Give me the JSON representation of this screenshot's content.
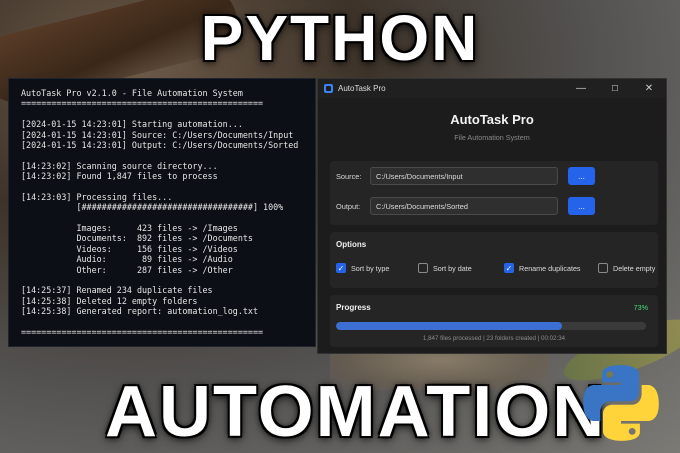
{
  "banner": {
    "top_text": "PYTHON",
    "bottom_text": "AUTOMATION"
  },
  "terminal": {
    "lines": [
      "AutoTask Pro v2.1.0 - File Automation System",
      "================================================",
      "",
      "[2024-01-15 14:23:01] Starting automation...",
      "[2024-01-15 14:23:01] Source: C:/Users/Documents/Input",
      "[2024-01-15 14:23:01] Output: C:/Users/Documents/Sorted",
      "",
      "[14:23:02] Scanning source directory...",
      "[14:23:02] Found 1,847 files to process",
      "",
      "[14:23:03] Processing files...",
      "           [##################################] 100%",
      "",
      "           Images:     423 files -> /Images",
      "           Documents:  892 files -> /Documents",
      "           Videos:     156 files -> /Videos",
      "           Audio:       89 files -> /Audio",
      "           Other:      287 files -> /Other",
      "",
      "[14:25:37] Renamed 234 duplicate files",
      "[14:25:38] Deleted 12 empty folders",
      "[14:25:38] Generated report: automation_log.txt",
      "",
      "================================================"
    ]
  },
  "window": {
    "title": "AutoTask Pro",
    "controls": {
      "minimize": "—",
      "maximize": "☐",
      "close": "✕"
    },
    "heading": "AutoTask Pro",
    "subtitle": "File Automation System",
    "source": {
      "label": "Source:",
      "value": "C:/Users/Documents/Input",
      "browse": "..."
    },
    "output": {
      "label": "Output:",
      "value": "C:/Users/Documents/Sorted",
      "browse": "..."
    },
    "options": {
      "title": "Options",
      "items": [
        {
          "label": "Sort by type",
          "checked": true
        },
        {
          "label": "Sort by date",
          "checked": false
        },
        {
          "label": "Rename duplicates",
          "checked": true
        },
        {
          "label": "Delete empty",
          "checked": false
        }
      ]
    },
    "progress": {
      "title": "Progress",
      "percent_label": "73%",
      "percent": 73,
      "status": "1,847 files processed | 23 folders created | 00:02:34"
    }
  },
  "colors": {
    "accent": "#2563eb",
    "progress_fill": "#3b6fd4",
    "progress_pct": "#4ade80",
    "python_blue": "#3a74c4",
    "python_yellow": "#ffd43b"
  },
  "icons": {
    "app": "app-window-icon",
    "python": "python-logo-icon"
  }
}
